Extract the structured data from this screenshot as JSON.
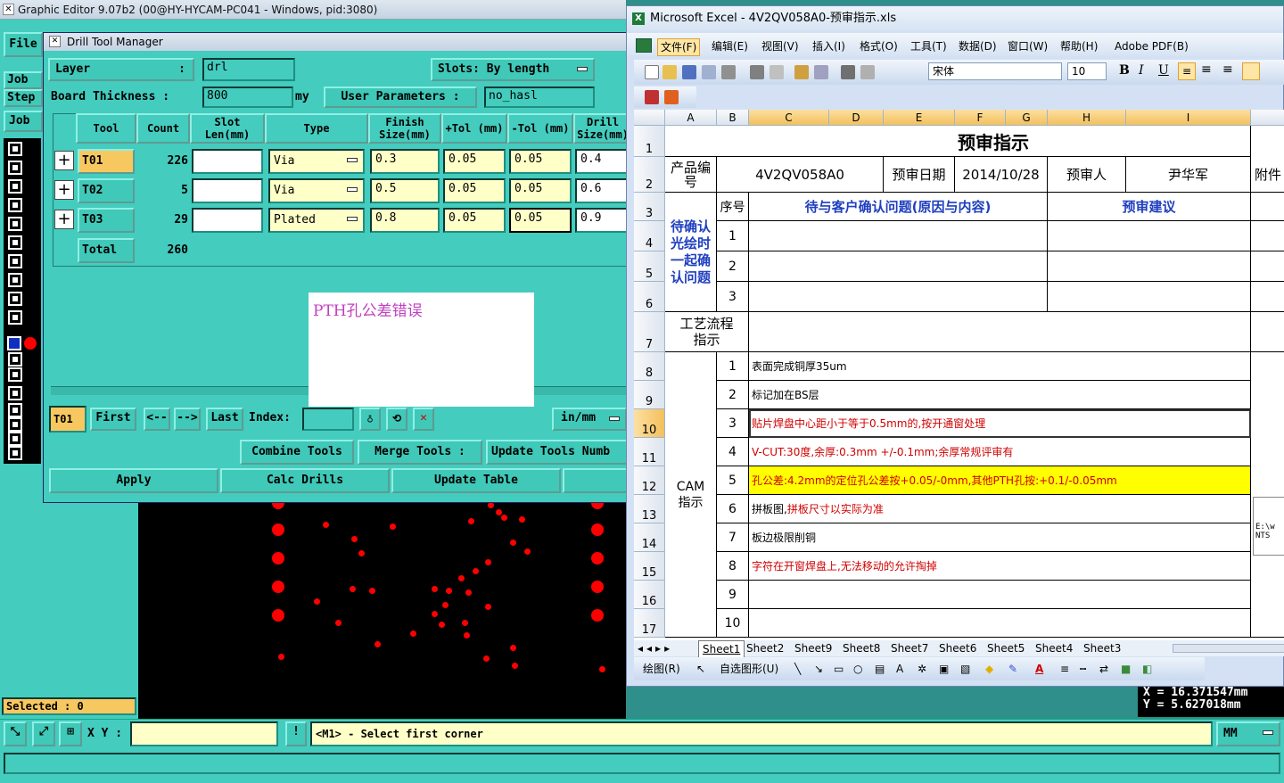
{
  "main_window": {
    "title": "Graphic Editor 9.07b2 (00@HY-HYCAM-PC041 - Windows, pid:3080)",
    "menu_file": "File",
    "left_buttons": [
      "Job",
      "Step",
      "Job"
    ],
    "selected": "Selected : 0",
    "xy_label": "X Y :",
    "xy_value": "",
    "status_msg": "<M1> - Select first corner",
    "units_combo": "MM",
    "coord_x": "X  =  16.371547mm",
    "coord_y": "Y  =  5.627018mm"
  },
  "drill_tool_manager": {
    "title": "Drill Tool Manager",
    "layer_label": "Layer",
    "layer_value": "drl",
    "slots_label": "Slots:",
    "slots_value": "By length",
    "board_thickness_label": "Board Thickness :",
    "board_thickness_value": "800",
    "board_thickness_unit": "my",
    "user_params_label": "User Parameters :",
    "user_params_value": "no_hasl",
    "headers": [
      "Tool",
      "Count",
      "Slot Len(mm)",
      "Type",
      "Finish Size(mm)",
      "+Tol (mm)",
      "-Tol (mm)",
      "Drill Size(mm)"
    ],
    "rows": [
      {
        "tool": "T01",
        "count": "226",
        "slot_len": "",
        "type": "Via",
        "finish": "0.3",
        "ptol": "0.05",
        "ntol": "0.05",
        "drill": "0.4"
      },
      {
        "tool": "T02",
        "count": "5",
        "slot_len": "",
        "type": "Via",
        "finish": "0.5",
        "ptol": "0.05",
        "ntol": "0.05",
        "drill": "0.6"
      },
      {
        "tool": "T03",
        "count": "29",
        "slot_len": "",
        "type": "Plated",
        "finish": "0.8",
        "ptol": "0.05",
        "ntol": "0.05",
        "drill": "0.9"
      }
    ],
    "total_label": "Total",
    "total_value": "260",
    "popup_text": "PTH孔公差错误",
    "current_tool": "T01",
    "nav": {
      "first": "First",
      "prev": "<--",
      "next": "-->",
      "last": "Last",
      "index_label": "Index:",
      "index_value": ""
    },
    "units": "in/mm",
    "combine": "Combine Tools",
    "merge": "Merge Tools :",
    "update_numbers": "Update Tools Numb",
    "apply": "Apply",
    "calc": "Calc Drills",
    "update_table": "Update Table"
  },
  "excel": {
    "title": "Microsoft Excel - 4V2QV058A0-预审指示.xls",
    "menus": [
      "文件(F)",
      "编辑(E)",
      "视图(V)",
      "插入(I)",
      "格式(O)",
      "工具(T)",
      "数据(D)",
      "窗口(W)",
      "帮助(H)",
      "Adobe PDF(B)"
    ],
    "font_name": "宋体",
    "font_size": "10",
    "columns": [
      "A",
      "B",
      "C",
      "D",
      "E",
      "F",
      "G",
      "H",
      "I"
    ],
    "rows": [
      "1",
      "2",
      "3",
      "4",
      "5",
      "6",
      "7",
      "8",
      "9",
      "10",
      "11",
      "12",
      "13",
      "14",
      "15",
      "16",
      "17"
    ],
    "sheet_title": "预审指示",
    "product_no_label": "产品编号",
    "product_no": "4V2QV058A0",
    "review_date_label": "预审日期",
    "review_date": "2014/10/28",
    "reviewer_label": "预审人",
    "reviewer": "尹华军",
    "attach_label": "附件",
    "seq_label": "序号",
    "confirm_header": "待与客户确认问题(原因与内容)",
    "suggest_header": "预审建议",
    "pending_label": "待确认光绘时一起确认问题",
    "pending_rows": [
      "1",
      "2",
      "3"
    ],
    "process_label": "工艺流程指示",
    "cam_label": "CAM指示",
    "cam_items": [
      {
        "n": "1",
        "text": "表面完成铜厚35um",
        "color": "black",
        "hl": false
      },
      {
        "n": "2",
        "text": "标记加在BS层",
        "color": "black",
        "hl": false
      },
      {
        "n": "3",
        "text": "贴片焊盘中心距小于等于0.5mm的,按开通窗处理",
        "color": "red",
        "hl": false
      },
      {
        "n": "4",
        "text": "V-CUT:30度,余厚:0.3mm +/-0.1mm;余厚常规评审有",
        "color": "red",
        "hl": false
      },
      {
        "n": "5",
        "text": "孔公差:4.2mm的定位孔公差按+0.05/-0mm,其他PTH孔按:+0.1/-0.05mm",
        "color": "red",
        "hl": true
      },
      {
        "n": "6",
        "text_a": "拼板图,",
        "text": "拼板尺寸以实际为准",
        "color": "red",
        "hl": false
      },
      {
        "n": "7",
        "text": "板边极限削铜",
        "color": "black",
        "hl": false
      },
      {
        "n": "8",
        "text": "字符在开窗焊盘上,无法移动的允许掏掉",
        "color": "red",
        "hl": false
      },
      {
        "n": "9",
        "text": "",
        "color": "black",
        "hl": false
      },
      {
        "n": "10",
        "text": "",
        "color": "black",
        "hl": false
      }
    ],
    "side_note": "E:\\w NTS",
    "sheet_tabs": [
      "Sheet1",
      "Sheet2",
      "Sheet9",
      "Sheet8",
      "Sheet7",
      "Sheet6",
      "Sheet5",
      "Sheet4",
      "Sheet3"
    ],
    "draw_label": "绘图(R)",
    "autoshape_label": "自选图形(U)"
  }
}
